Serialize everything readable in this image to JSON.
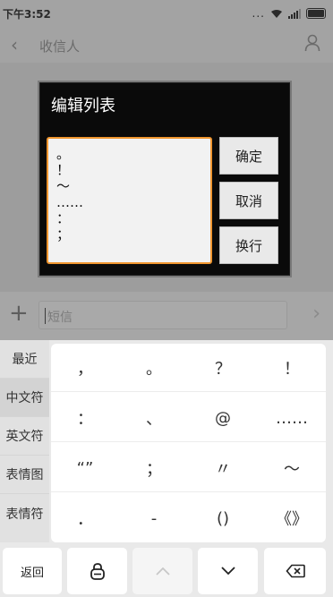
{
  "status_bar": {
    "time": "下午3:52",
    "dots": "..."
  },
  "header": {
    "recipient_label": "收信人"
  },
  "compose": {
    "placeholder": "短信"
  },
  "dialog": {
    "title": "编辑列表",
    "edit_lines": [
      "。",
      "！",
      "～",
      "……",
      "：",
      "；"
    ],
    "buttons": {
      "confirm": "确定",
      "cancel": "取消",
      "newline": "换行"
    }
  },
  "keyboard": {
    "categories": [
      "最近",
      "中文符",
      "英文符",
      "表情图",
      "表情符"
    ],
    "selected_category": "中文符",
    "symbols": [
      [
        "，",
        "。",
        "？",
        "！"
      ],
      [
        "：",
        "、",
        "@",
        "……"
      ],
      [
        "“”",
        "；",
        "〃",
        "～"
      ],
      [
        "．",
        "-",
        "()",
        "《》"
      ]
    ],
    "bottom": {
      "back": "返回"
    }
  },
  "colors": {
    "accent_border": "#f0962f",
    "dialog_bg": "#0a0a0a"
  }
}
